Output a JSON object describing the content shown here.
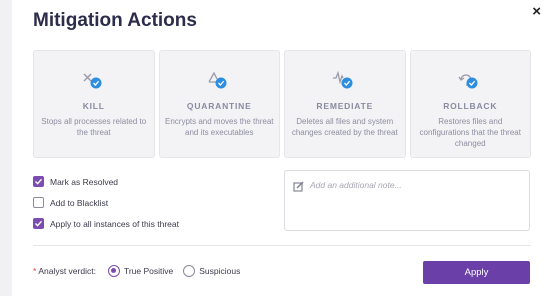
{
  "dialog": {
    "title": "Mitigation Actions",
    "close_glyph": "×"
  },
  "actions": [
    {
      "label": "KILL",
      "icon": "kill-icon",
      "desc": "Stops all processes related to the threat"
    },
    {
      "label": "QUARANTINE",
      "icon": "quarantine-icon",
      "desc": "Encrypts and moves the threat and its executables"
    },
    {
      "label": "REMEDIATE",
      "icon": "remediate-icon",
      "desc": "Deletes all files and system changes created by the threat"
    },
    {
      "label": "ROLLBACK",
      "icon": "rollback-icon",
      "desc": "Restores files and configurations that the threat changed"
    }
  ],
  "options": [
    {
      "label": "Mark as Resolved",
      "checked": true
    },
    {
      "label": "Add to Blacklist",
      "checked": false
    },
    {
      "label": "Apply to all instances of this threat",
      "checked": true
    }
  ],
  "note": {
    "placeholder": "Add an additional note..."
  },
  "verdict": {
    "required_mark": "*",
    "label": "Analyst verdict:",
    "options": [
      {
        "label": "True Positive",
        "selected": true
      },
      {
        "label": "Suspicious",
        "selected": false
      }
    ]
  },
  "apply_label": "Apply",
  "colors": {
    "accent": "#6b3fa8",
    "check": "#2d8ee0"
  }
}
